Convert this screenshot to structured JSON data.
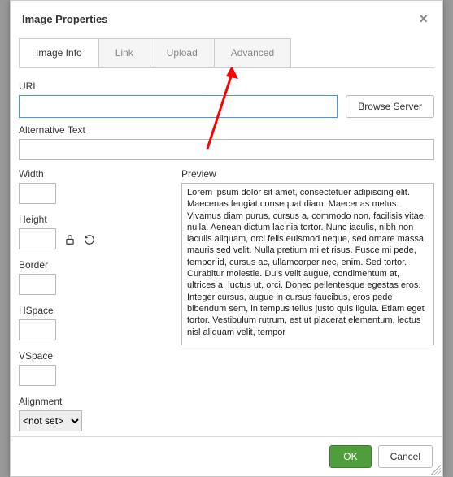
{
  "dialog": {
    "title": "Image Properties",
    "close_icon": "×"
  },
  "tabs": {
    "image_info": "Image Info",
    "link": "Link",
    "upload": "Upload",
    "advanced": "Advanced"
  },
  "fields": {
    "url_label": "URL",
    "url_value": "",
    "browse_label": "Browse Server",
    "alt_label": "Alternative Text",
    "alt_value": "",
    "width_label": "Width",
    "width_value": "",
    "height_label": "Height",
    "height_value": "",
    "border_label": "Border",
    "border_value": "",
    "hspace_label": "HSpace",
    "hspace_value": "",
    "vspace_label": "VSpace",
    "vspace_value": "",
    "alignment_label": "Alignment",
    "alignment_value": "<not set>"
  },
  "preview": {
    "label": "Preview",
    "text": "Lorem ipsum dolor sit amet, consectetuer adipiscing elit. Maecenas feugiat consequat diam. Maecenas metus. Vivamus diam purus, cursus a, commodo non, facilisis vitae, nulla. Aenean dictum lacinia tortor. Nunc iaculis, nibh non iaculis aliquam, orci felis euismod neque, sed ornare massa mauris sed velit. Nulla pretium mi et risus. Fusce mi pede, tempor id, cursus ac, ullamcorper nec, enim. Sed tortor. Curabitur molestie. Duis velit augue, condimentum at, ultrices a, luctus ut, orci. Donec pellentesque egestas eros. Integer cursus, augue in cursus faucibus, eros pede bibendum sem, in tempus tellus justo quis ligula. Etiam eget tortor. Vestibulum rutrum, est ut placerat elementum, lectus nisl aliquam velit, tempor"
  },
  "footer": {
    "ok": "OK",
    "cancel": "Cancel"
  },
  "annotation": {
    "arrow_color": "#ff0000"
  }
}
